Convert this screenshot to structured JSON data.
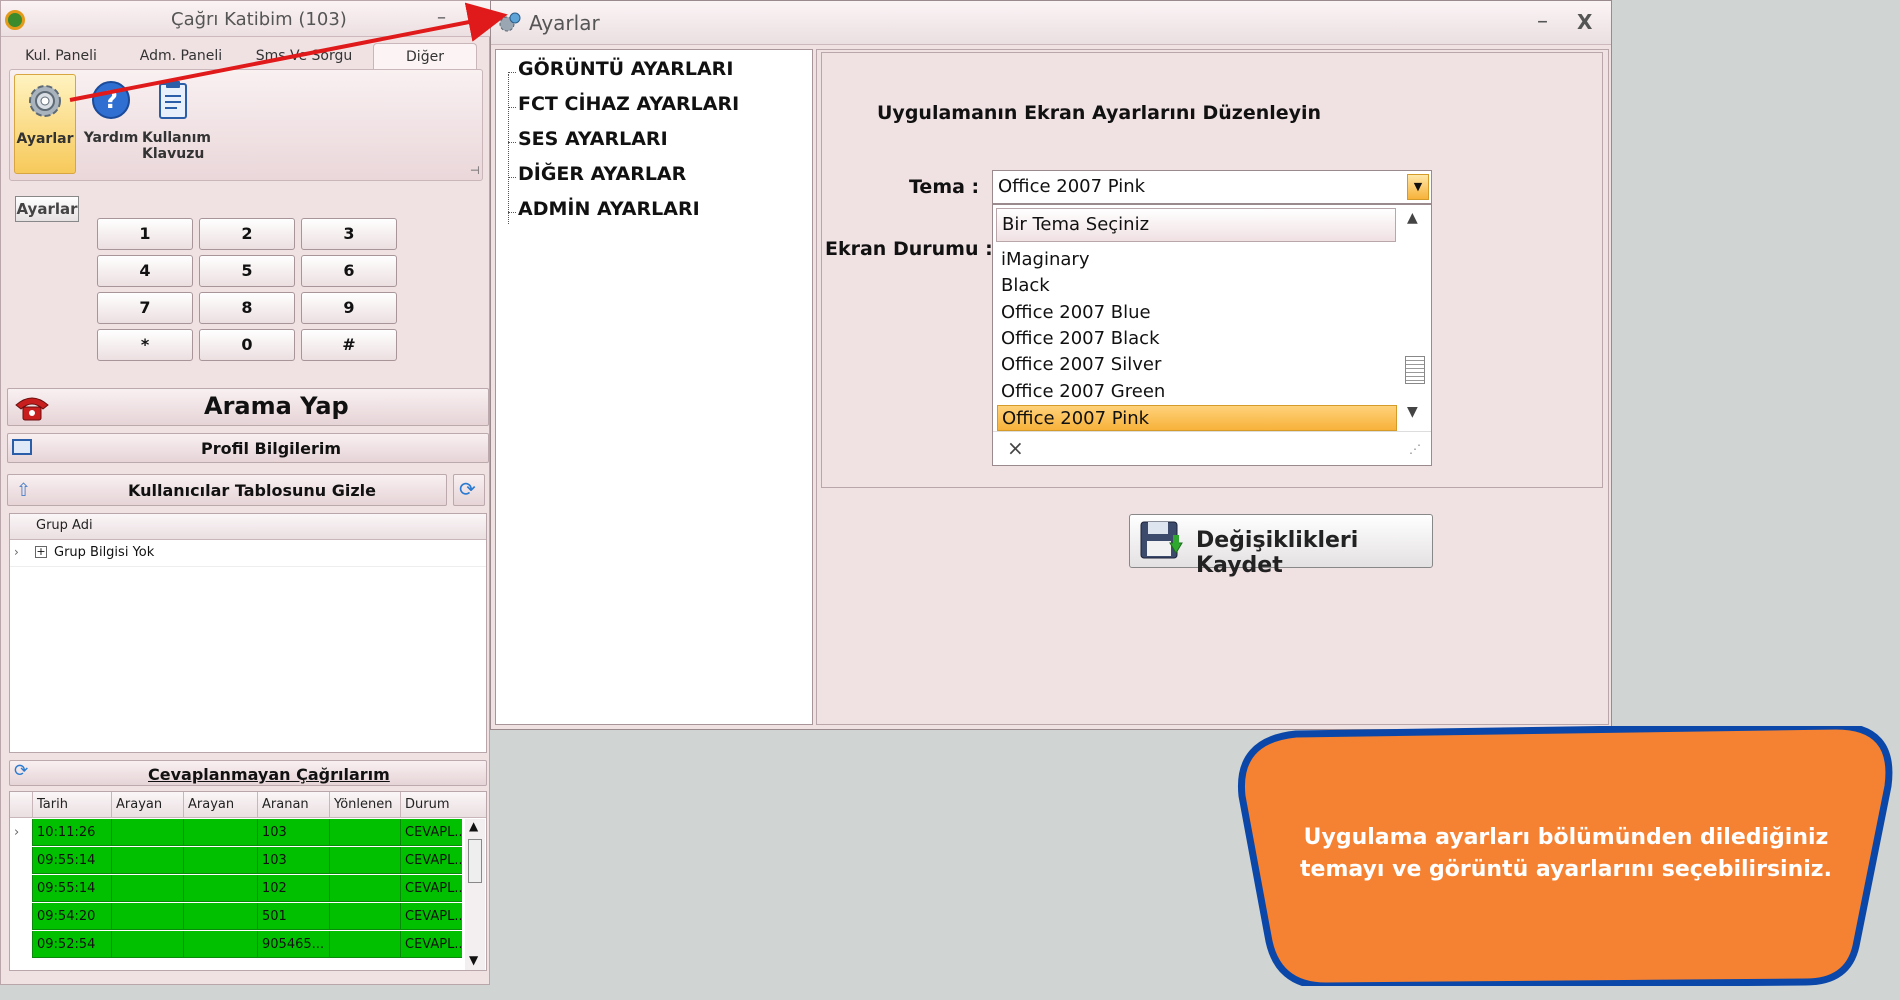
{
  "left_window": {
    "title": "Çağrı Katibim (103)",
    "minimize": "–",
    "close": "X",
    "tabs": [
      "Kul. Paneli",
      "Adm. Paneli",
      "Sms Ve Sorgu",
      "Diğer"
    ],
    "ribbon_buttons": [
      {
        "label": "Ayarlar",
        "icon": "gear-icon"
      },
      {
        "label": "Yardım",
        "icon": "help-icon"
      },
      {
        "label": "Kullanım\nKlavuzu",
        "icon": "clipboard-icon"
      }
    ],
    "tooltip": "Ayarlar",
    "keypad": [
      "1",
      "2",
      "3",
      "4",
      "5",
      "6",
      "7",
      "8",
      "9",
      "*",
      "0",
      "#"
    ],
    "call_button": "Arama Yap",
    "profile_button": "Profil Bilgilerim",
    "users_toggle": "Kullanıcılar Tablosunu Gizle",
    "users_grid": {
      "header": "Grup Adi",
      "rows": [
        "Grup Bilgisi Yok"
      ]
    },
    "missed_header": "Cevaplanmayan Çağrılarım",
    "missed_grid": {
      "columns": [
        "Tarih",
        "Arayan",
        "Arayan",
        "Aranan",
        "Yönlenen",
        "Durum"
      ],
      "rows": [
        [
          "10:11:26",
          "",
          "",
          "103",
          "",
          "CEVAPL..."
        ],
        [
          "09:55:14",
          "",
          "",
          "103",
          "",
          "CEVAPL..."
        ],
        [
          "09:55:14",
          "",
          "",
          "102",
          "",
          "CEVAPL..."
        ],
        [
          "09:54:20",
          "",
          "",
          "501",
          "",
          "CEVAPL..."
        ],
        [
          "09:52:54",
          "",
          "",
          "905465...",
          "",
          "CEVAPL..."
        ]
      ],
      "row_color": "#00c000"
    }
  },
  "settings_window": {
    "title": "Ayarlar",
    "minimize": "–",
    "close": "X",
    "tree": [
      "GÖRÜNTÜ AYARLARI",
      "FCT CİHAZ AYARLARI",
      "SES AYARLARI",
      "DİĞER AYARLAR",
      "ADMİN AYARLARI"
    ],
    "heading": "Uygulamanın Ekran Ayarlarını Düzenleyin",
    "theme_label": "Tema :",
    "screen_label": "Ekran Durumu :",
    "theme_value": "Office 2007 Pink",
    "dropdown_header": "Bir Tema Seçiniz",
    "dropdown_options": [
      "iMaginary",
      "Black",
      "Office 2007 Blue",
      "Office 2007 Black",
      "Office 2007 Silver",
      "Office 2007 Green",
      "Office 2007 Pink"
    ],
    "dropdown_close": "×",
    "save_button": "Değişiklikleri Kaydet"
  },
  "callout": {
    "text": "Uygulama ayarları bölümünden dilediğiniz temayı ve görüntü ayarlarını seçebilirsiniz.",
    "fill": "#f58132",
    "border": "#0a47a8"
  },
  "colors": {
    "window_bg": "#f0e1e3",
    "arrow": "#e01a1a",
    "selected": "#f7b23a"
  }
}
